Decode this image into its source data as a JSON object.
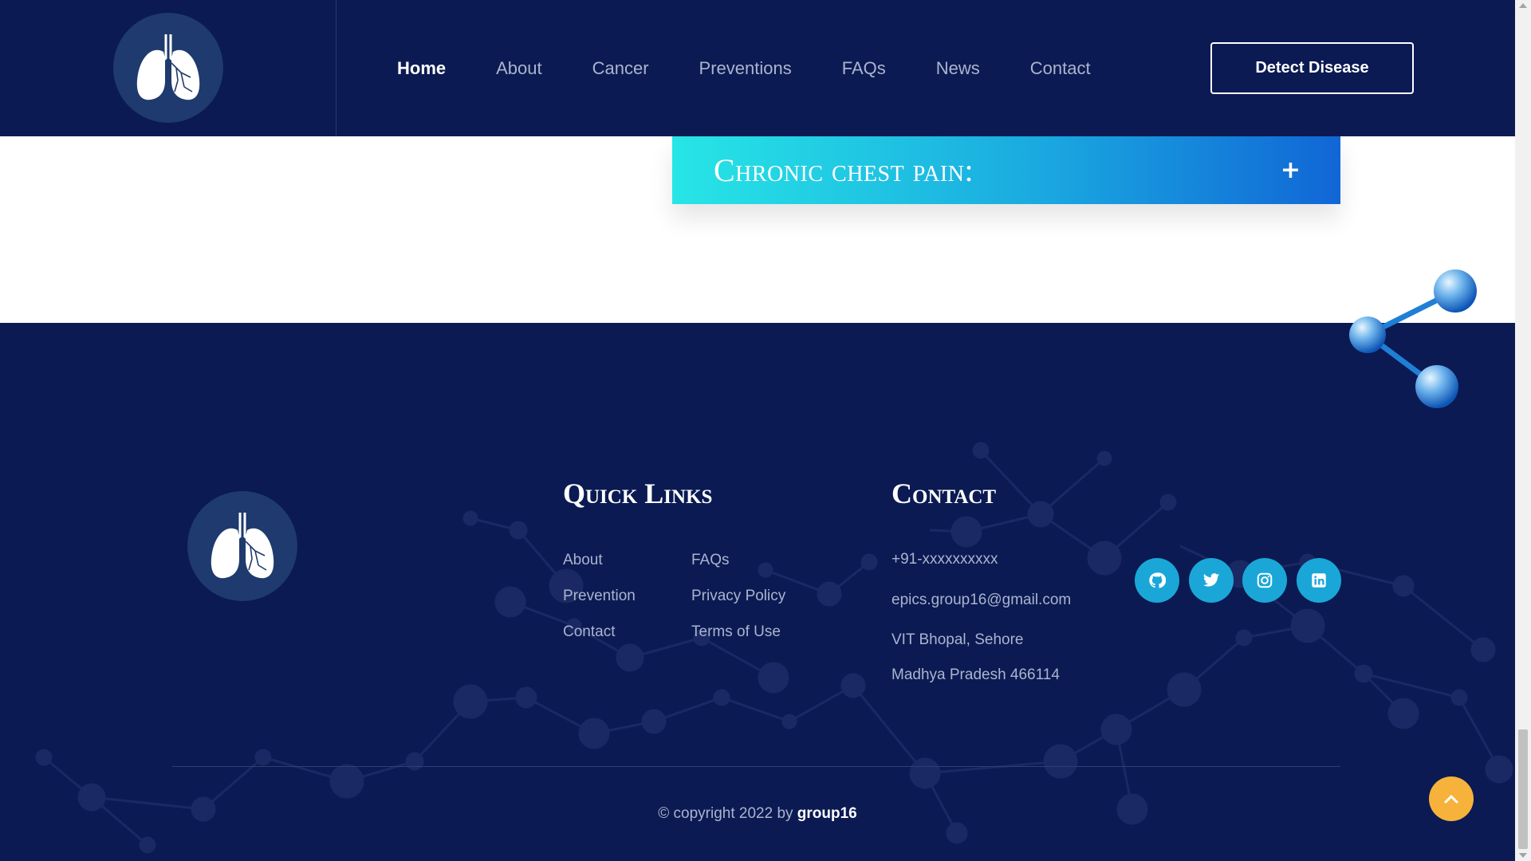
{
  "navbar": {
    "links": [
      {
        "label": "Home",
        "active": true
      },
      {
        "label": "About",
        "active": false
      },
      {
        "label": "Cancer",
        "active": false
      },
      {
        "label": "Preventions",
        "active": false
      },
      {
        "label": "FAQs",
        "active": false
      },
      {
        "label": "News",
        "active": false
      },
      {
        "label": "Contact",
        "active": false
      }
    ],
    "cta_label": "Detect Disease"
  },
  "accordion": {
    "title": "Chronic chest pain:",
    "toggle_symbol": "+"
  },
  "footer": {
    "quick_links_heading": "Quick Links",
    "quick_links": {
      "col1": [
        "About",
        "Prevention",
        "Contact"
      ],
      "col2": [
        "FAQs",
        "Privacy Policy",
        "Terms of Use"
      ]
    },
    "contact_heading": "Contact",
    "contact": {
      "phone": "+91-xxxxxxxxxx",
      "email": "epics.group16@gmail.com",
      "address_line1": "VIT Bhopal, Sehore",
      "address_line2": "Madhya Pradesh 466114"
    },
    "social_icons": [
      "github-icon",
      "twitter-icon",
      "instagram-icon",
      "linkedin-icon"
    ],
    "copyright_prefix": "© copyright 2022 by ",
    "copyright_owner": "group16"
  },
  "colors": {
    "navy": "#0b1a52",
    "accent_cyan": "#1aa7d8",
    "gradient_start": "#27e6e6",
    "gradient_end": "#1166d6",
    "scroll_top": "#f6b23a"
  }
}
